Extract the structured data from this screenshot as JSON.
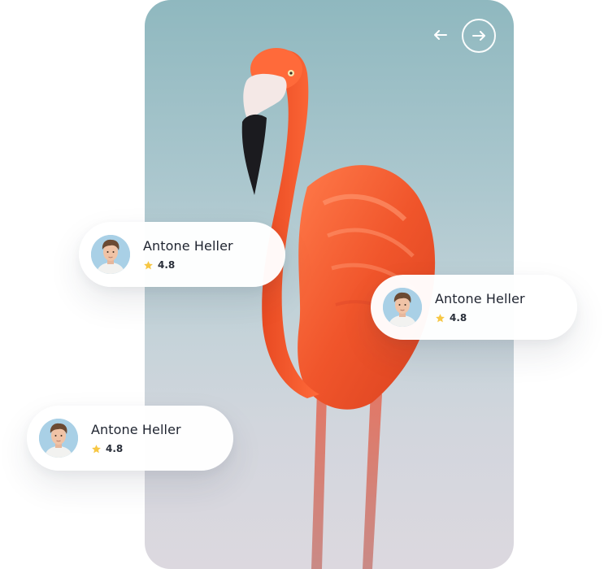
{
  "photo": {
    "subject": "flamingo"
  },
  "navigation": {
    "prev_icon": "arrow-left-icon",
    "next_icon": "arrow-right-icon"
  },
  "reviews": [
    {
      "name": "Antone Heller",
      "rating": "4.8",
      "avatar_icon": "user-avatar",
      "star_icon": "star-icon"
    },
    {
      "name": "Antone Heller",
      "rating": "4.8",
      "avatar_icon": "user-avatar",
      "star_icon": "star-icon"
    },
    {
      "name": "Antone Heller",
      "rating": "4.8",
      "avatar_icon": "user-avatar",
      "star_icon": "star-icon"
    }
  ],
  "colors": {
    "star": "#f7c744",
    "flamingo": "#f05a2e",
    "text": "#1f2430"
  }
}
